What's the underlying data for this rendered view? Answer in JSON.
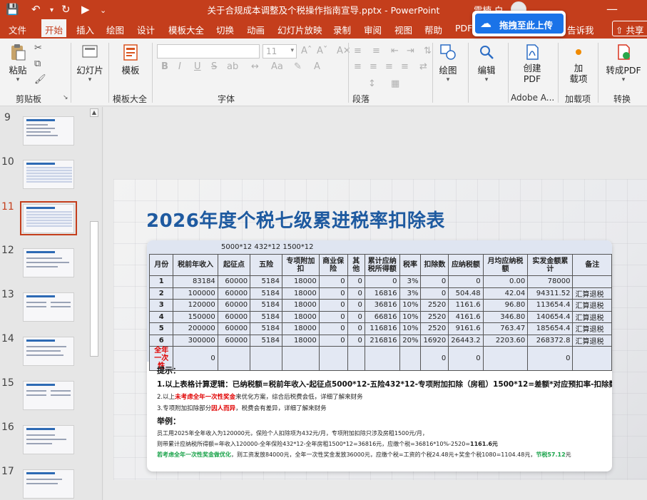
{
  "app": {
    "window_title": "关于合规成本调整及个税操作指南宣导.pptx  -  PowerPoint",
    "user_name": "雪楠 白",
    "share_label": "共享",
    "tell_me": "告诉我",
    "upload_popup_label": "拖拽至此上传"
  },
  "tabs": [
    "文件",
    "开始",
    "插入",
    "绘图",
    "设计",
    "模板大全",
    "切换",
    "动画",
    "幻灯片放映",
    "录制",
    "审阅",
    "视图",
    "帮助",
    "PDF"
  ],
  "active_tab": "开始",
  "ribbon": {
    "paste": "粘贴",
    "clipboard": "剪贴板",
    "slides": "幻灯片",
    "template": "模板",
    "template_group": "模板大全",
    "font_group": "字体",
    "font_size": "11",
    "paragraph_group": "段落",
    "drawing": "绘图",
    "editing": "编辑",
    "create_pdf": "创建\nPDF",
    "adobe_group": "Adobe A...",
    "addins": "加\n载项",
    "addins_group": "加载项",
    "convert_pdf": "转成PDF",
    "convert_group": "转换",
    "bold": "B",
    "italic": "I",
    "underline": "U",
    "strike": "S",
    "shadow": "ab"
  },
  "thumbnails": [
    {
      "num": "9"
    },
    {
      "num": "10"
    },
    {
      "num": "11"
    },
    {
      "num": "12"
    },
    {
      "num": "13"
    },
    {
      "num": "14"
    },
    {
      "num": "15"
    },
    {
      "num": "16"
    },
    {
      "num": "17"
    }
  ],
  "current_slide": "11",
  "slide": {
    "title": "2026年度个税七级累进税率扣除表",
    "formula_note": "5000*12   432*12    1500*12",
    "table": {
      "headers": [
        "月份",
        "税前年收入",
        "起征点",
        "五险",
        "专项附加扣",
        "商业保险",
        "其他",
        "累计应纳税所得额",
        "税率",
        "扣除数",
        "应纳税额",
        "月均应纳税额",
        "实发金额累计",
        "备注"
      ],
      "rows": [
        [
          "1",
          "83184",
          "60000",
          "5184",
          "18000",
          "0",
          "0",
          "0",
          "3%",
          "0",
          "0",
          "0.00",
          "78000",
          ""
        ],
        [
          "2",
          "100000",
          "60000",
          "5184",
          "18000",
          "0",
          "0",
          "16816",
          "3%",
          "0",
          "504.48",
          "42.04",
          "94311.52",
          "汇算退税"
        ],
        [
          "3",
          "120000",
          "60000",
          "5184",
          "18000",
          "0",
          "0",
          "36816",
          "10%",
          "2520",
          "1161.6",
          "96.80",
          "113654.4",
          "汇算退税"
        ],
        [
          "4",
          "150000",
          "60000",
          "5184",
          "18000",
          "0",
          "0",
          "66816",
          "10%",
          "2520",
          "4161.6",
          "346.80",
          "140654.4",
          "汇算退税"
        ],
        [
          "5",
          "200000",
          "60000",
          "5184",
          "18000",
          "0",
          "0",
          "116816",
          "10%",
          "2520",
          "9161.6",
          "763.47",
          "185654.4",
          "汇算退税"
        ],
        [
          "6",
          "300000",
          "60000",
          "5184",
          "18000",
          "0",
          "0",
          "216816",
          "20%",
          "16920",
          "26443.2",
          "2203.60",
          "268372.8",
          "汇算退税"
        ],
        [
          "全年一次性",
          "0",
          "",
          "",
          "",
          "",
          "",
          "",
          "",
          "0",
          "0",
          "",
          "0",
          ""
        ]
      ]
    },
    "tips_heading": "提示：",
    "tip1": "1.以上表格计算逻辑：已纳税额=税前年收入-起征点5000*12-五险432*12-专项附加扣除（房租）1500*12=差额*对应预扣率-扣除数",
    "tip2_a": "2.以上",
    "tip2_red": "未考虑全年一次性奖金",
    "tip2_b": "来优化方案，综合后税费会低，详细了解来财务",
    "tip3_a": "3.专项附加扣除部分",
    "tip3_red": "因人而异",
    "tip3_b": "，税费会有差异，详细了解来财务",
    "example_heading": "举例：",
    "ex1": "员工用2025年全年收入为120000元，保险个人扣除项为432元/月，专项附加扣除只涉及房租1500元/月，",
    "ex2_a": "则带累计应纳税所得额=年收入120000-全年保险432*12-全年房租1500*12=36816元，应缴个税=36816*10%-2520=",
    "ex2_b": "1161.6元",
    "ex3_green": "若考虑全年一次性奖金做优化",
    "ex3_b": "，则工资发放84000元，全年一次性奖金发放36000元，应缴个税=工资的个税24.48元+奖金个税1080=1104.48元，",
    "ex3_green2": "节税57.12",
    "ex3_c": "元"
  }
}
